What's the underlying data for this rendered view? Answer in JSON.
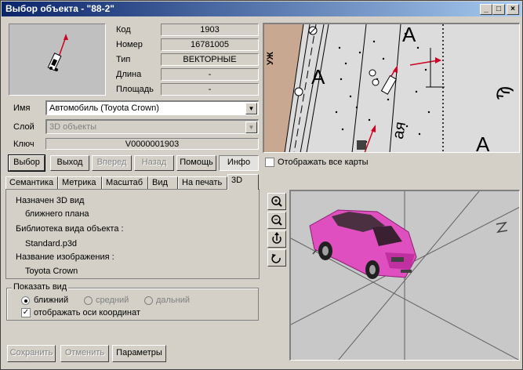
{
  "window": {
    "title": "Выбор объекта - \"88-2\"",
    "controls": {
      "minimize": "_",
      "maximize": "□",
      "close": "×"
    }
  },
  "props": {
    "code_label": "Код",
    "code_value": "1903",
    "number_label": "Номер",
    "number_value": "16781005",
    "type_label": "Тип",
    "type_value": "ВЕКТОРНЫЕ",
    "length_label": "Длина",
    "length_value": "-",
    "area_label": "Площадь",
    "area_value": "-"
  },
  "name": {
    "label": "Имя",
    "value": "Автомобиль (Toyota Crown)"
  },
  "layer": {
    "label": "Слой",
    "value": "3D объекты"
  },
  "key": {
    "label": "Ключ",
    "value": "V0000001903"
  },
  "buttons": {
    "select": "Выбор",
    "exit": "Выход",
    "forward": "Вперед",
    "back": "Назад",
    "help": "Помощь",
    "info": "Инфо"
  },
  "map": {
    "show_all_label": "Отображать все карты",
    "street_label": "УЖ",
    "letter": "А",
    "text_fragment": "ая"
  },
  "tabs": [
    "Семантика",
    "Метрика",
    "Масштаб",
    "Вид",
    "На печать",
    "3D"
  ],
  "view3d": {
    "assigned_label": "Назначен 3D вид",
    "assigned_value": "ближнего плана",
    "library_label": "Библиотека вида объекта :",
    "library_value": "Standard.p3d",
    "image_label": "Название изображения :",
    "image_value": "Toyota Crown"
  },
  "show_view": {
    "legend": "Показать вид",
    "near": "ближний",
    "medium": "средний",
    "far": "дальний",
    "axes": "отображать оси координат"
  },
  "bottom_buttons": {
    "save": "Сохранить",
    "cancel": "Отменить",
    "params": "Параметры"
  },
  "colors": {
    "car": "#e04fc0",
    "title_start": "#0a246a",
    "title_end": "#a6caf0"
  }
}
